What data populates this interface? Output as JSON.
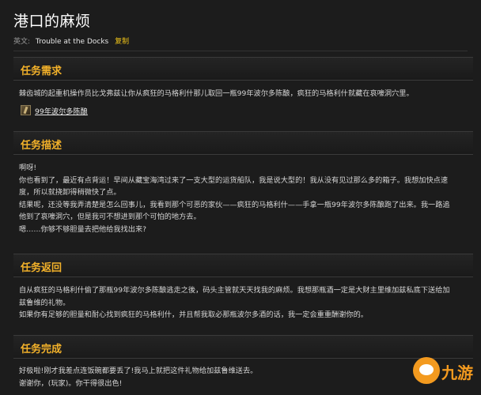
{
  "page": {
    "title": "港口的麻烦",
    "english_label": "英文:",
    "english_name": "Trouble at the Docks",
    "copy_label": "复制"
  },
  "sections": [
    {
      "heading": "任务需求",
      "lines": [
        "棘齿城的起重机操作员比戈弗兹让你从疯狂的马格利什那儿取回一瓶99年波尔多陈酿，疯狂的马格利什就藏在哀嚎洞穴里。"
      ],
      "item": {
        "label": "99年波尔多陈酿",
        "icon": "wine-bottle-icon"
      }
    },
    {
      "heading": "任务描述",
      "lines": [
        "啊呀!",
        "你也看到了，最近有点背运！早间从藏宝海湾过来了一支大型的运货船队，我是说大型的！我从没有见过那么多的箱子。我想加快点速",
        "度，所以就挠卸得稍微快了点。",
        "结果呢，还没等我弄清楚是怎么回事儿，我看到那个可恶的家伙——疯狂的马格利什——手拿一瓶99年波尔多陈酿跑了出来。我一路追",
        "他到了哀嚎洞穴，但是我可不想进到那个可怕的地方去。",
        "嗯……你够不够胆量去把他给我找出来?"
      ]
    },
    {
      "heading": "任务返回",
      "lines": [
        "自从疯狂的马格利什偷了那瓶99年波尔多陈酿逃走之後，码头主管就天天找我的麻烦。我想那瓶酒一定是大财主里维加兹私底下送给加",
        "兹鲁维的礼物。",
        "如果你有足够的胆量和耐心找到疯狂的马格利什，并且帮我取必那瓶波尔多酒的话，我一定会重重酬谢你的。"
      ]
    },
    {
      "heading": "任务完成",
      "lines": [
        "好极啦!刚才我差点连饭碗都要丢了!我马上就把这件礼物给加兹鲁维送去。",
        "谢谢你，(玩家)。你干得很出色!"
      ]
    }
  ],
  "watermark": {
    "text": "九游",
    "icon": "jiuyou-logo-icon",
    "color": "#f39a1f"
  }
}
